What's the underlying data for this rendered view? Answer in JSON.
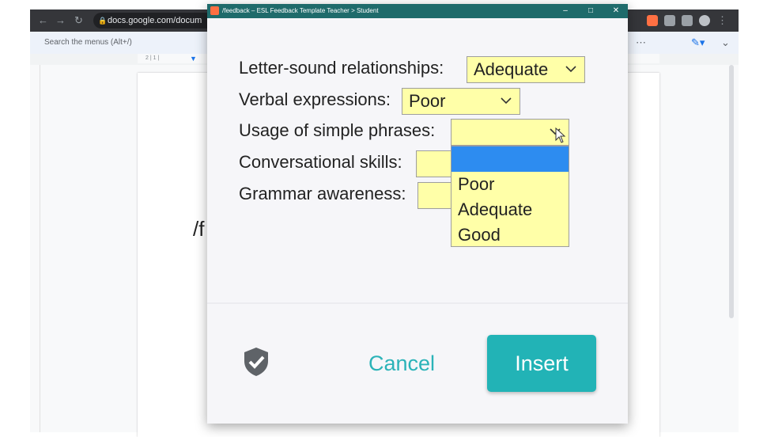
{
  "browser": {
    "url": "docs.google.com/docum",
    "menu_search_placeholder": "Search the menus (Alt+/)",
    "doc_text": "/f",
    "ruler_marks": "2 | 1 |"
  },
  "popup": {
    "title": "/feedback – ESL Feedback Template Teacher > Student",
    "controls": {
      "minimize": "–",
      "maximize": "□",
      "close": "✕"
    },
    "fields": [
      {
        "label": "Letter-sound relationships:",
        "value": "Adequate"
      },
      {
        "label": "Verbal expressions:",
        "value": "Poor"
      },
      {
        "label": "Usage of simple phrases:",
        "value": ""
      },
      {
        "label": "Conversational skills:",
        "value": ""
      },
      {
        "label": "Grammar awareness:",
        "value": ""
      }
    ],
    "dropdown_options": [
      "",
      "Poor",
      "Adequate",
      "Good"
    ],
    "selected_option_index": 0,
    "cancel_label": "Cancel",
    "insert_label": "Insert",
    "colors": {
      "titlebar": "#1f6b6b",
      "select_bg": "#ffffa8",
      "highlight": "#2d8cf0",
      "accent": "#22b3b6"
    }
  }
}
